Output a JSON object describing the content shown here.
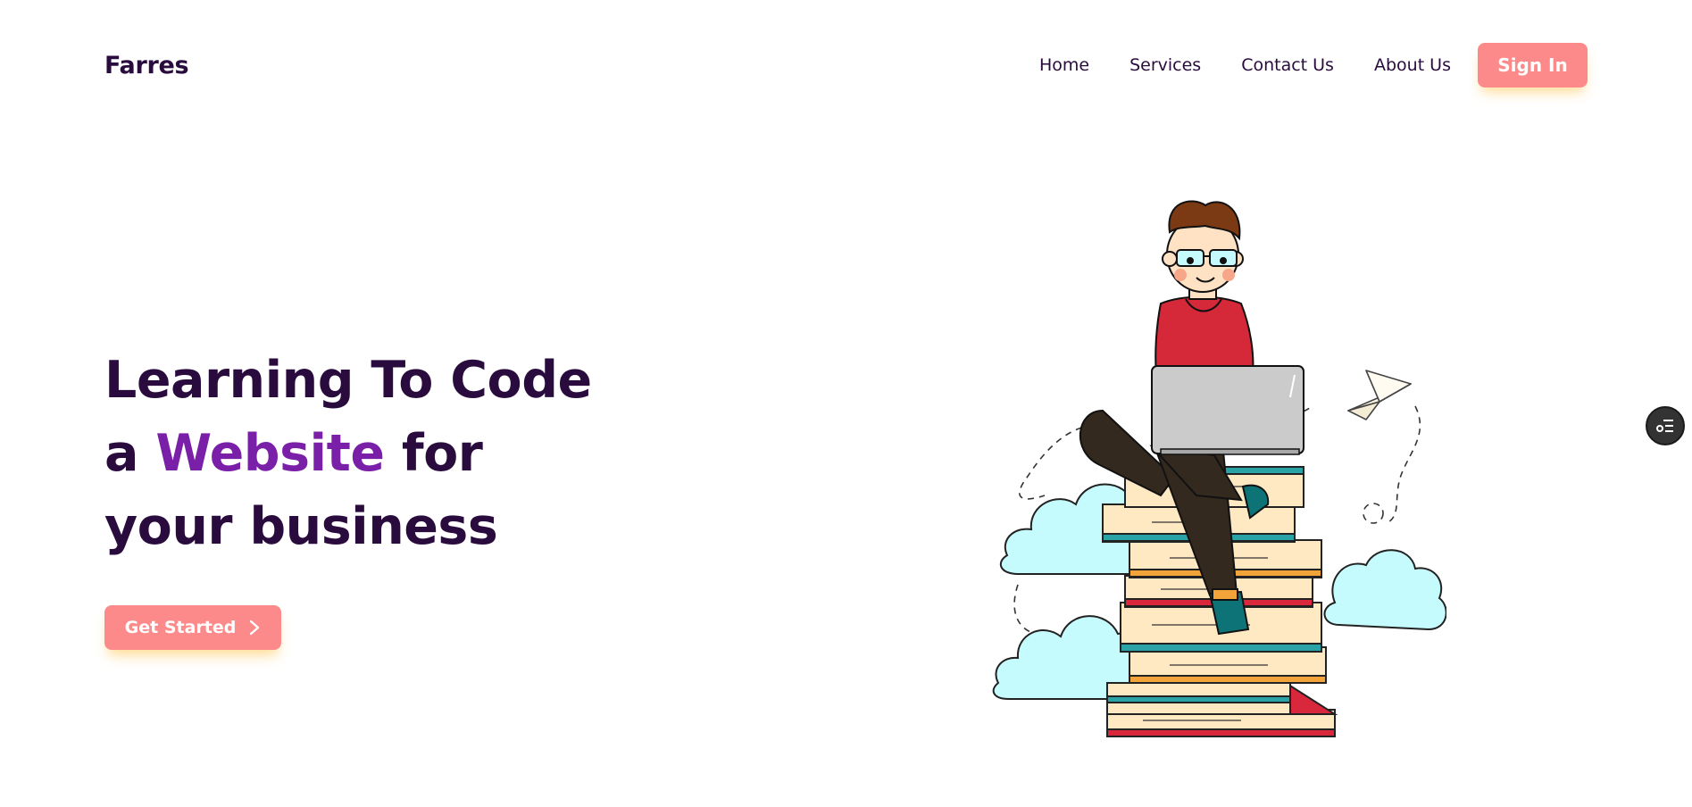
{
  "brand": {
    "logo_text": "Farres"
  },
  "nav": {
    "items": [
      {
        "label": "Home"
      },
      {
        "label": "Services"
      },
      {
        "label": "Contact Us"
      },
      {
        "label": "About Us"
      }
    ],
    "signin_label": "Sign In"
  },
  "hero": {
    "line1": "Learning To Code",
    "line2_prefix": "a ",
    "line2_accent": "Website",
    "line2_suffix": " for",
    "line3": "your business",
    "cta_label": "Get Started"
  },
  "icons": {
    "cta_icon": "chevron-right-icon",
    "widget_icon": "list-settings-icon",
    "illustration": "developer-on-books-illustration"
  },
  "colors": {
    "primary_text": "#2a0b3e",
    "accent_purple": "#7a1fa8",
    "button_pink": "#fc8a8a",
    "button_shadow": "#ffd682",
    "cloud": "#c6fbfd"
  }
}
